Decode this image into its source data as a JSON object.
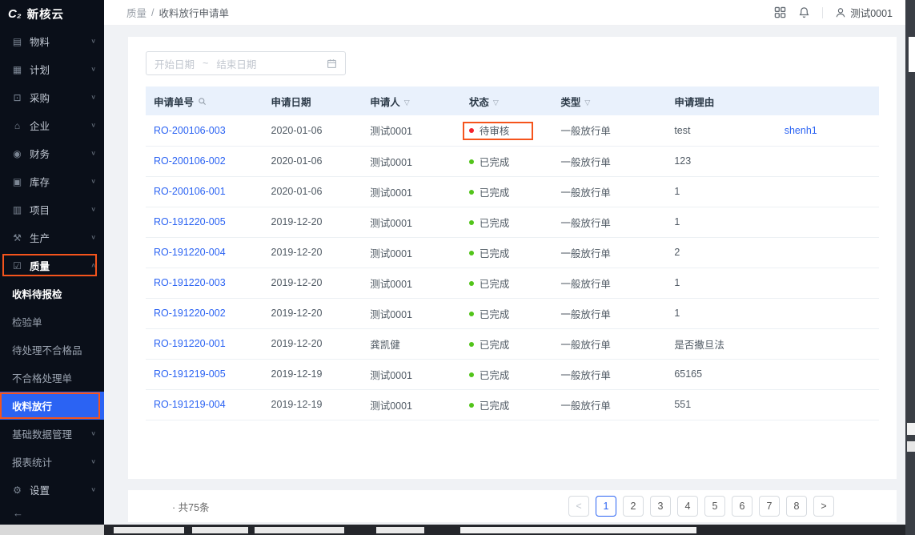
{
  "app": {
    "logo_mark": "C₂",
    "logo_text": "新核云"
  },
  "topbar": {
    "breadcrumb": {
      "section": "质量",
      "separator": "/",
      "page": "收料放行申请单"
    },
    "user": "测试0001"
  },
  "annotations": {
    "color": "#f5541c"
  },
  "icon_glyphs": {
    "materials-icon": "▤",
    "plan-icon": "▦",
    "purchase-icon": "⊡",
    "enterprise-icon": "⌂",
    "finance-icon": "◉",
    "inventory-icon": "▣",
    "project-icon": "▥",
    "production-icon": "⚒",
    "quality-icon": "☑",
    "settings-icon": "⚙",
    "chevron-down-icon": "∨",
    "chevron-up-icon": "∧",
    "filter-icon": "▽"
  },
  "sidebar": {
    "items": [
      {
        "name": "materials",
        "label": "物料",
        "icon": "materials-icon",
        "chevron": "down",
        "type": "top"
      },
      {
        "name": "plan",
        "label": "计划",
        "icon": "plan-icon",
        "chevron": "down",
        "type": "top"
      },
      {
        "name": "purchase",
        "label": "采购",
        "icon": "purchase-icon",
        "chevron": "down",
        "type": "top"
      },
      {
        "name": "enterprise",
        "label": "企业",
        "icon": "enterprise-icon",
        "chevron": "down",
        "type": "top"
      },
      {
        "name": "finance",
        "label": "财务",
        "icon": "finance-icon",
        "chevron": "down",
        "type": "top"
      },
      {
        "name": "inventory",
        "label": "库存",
        "icon": "inventory-icon",
        "chevron": "down",
        "type": "top"
      },
      {
        "name": "project",
        "label": "项目",
        "icon": "project-icon",
        "chevron": "down",
        "type": "top"
      },
      {
        "name": "production",
        "label": "生产",
        "icon": "production-icon",
        "chevron": "down",
        "type": "top"
      },
      {
        "name": "quality",
        "label": "质量",
        "icon": "quality-icon",
        "chevron": "up",
        "type": "top",
        "emphasized": true,
        "annotated": true
      },
      {
        "name": "receiving-pending-inspection",
        "label": "收料待报检",
        "type": "sub",
        "emphasized": true
      },
      {
        "name": "inspection-order",
        "label": "检验单",
        "type": "sub"
      },
      {
        "name": "pending-nonconforming",
        "label": "待处理不合格品",
        "type": "sub"
      },
      {
        "name": "nonconforming-order",
        "label": "不合格处理单",
        "type": "sub"
      },
      {
        "name": "receiving-release",
        "label": "收料放行",
        "type": "sub",
        "active": true,
        "annotated": true
      },
      {
        "name": "basic-data-management",
        "label": "基础数据管理",
        "type": "sub",
        "chevron": "down"
      },
      {
        "name": "report-statistics",
        "label": "报表统计",
        "type": "sub",
        "chevron": "down"
      },
      {
        "name": "settings",
        "label": "设置",
        "icon": "settings-icon",
        "chevron": "down",
        "type": "top"
      }
    ],
    "collapse_label": "←"
  },
  "filter": {
    "start_placeholder": "开始日期",
    "tilde": "~",
    "end_placeholder": "结束日期"
  },
  "table": {
    "headers": [
      {
        "name": "order-no",
        "label": "申请单号",
        "icon": "search-icon"
      },
      {
        "name": "apply-date",
        "label": "申请日期"
      },
      {
        "name": "applicant",
        "label": "申请人",
        "icon": "filter-icon"
      },
      {
        "name": "status",
        "label": "状态",
        "icon": "filter-icon"
      },
      {
        "name": "type",
        "label": "类型",
        "icon": "filter-icon"
      },
      {
        "name": "reason",
        "label": "申请理由"
      },
      {
        "name": "extra",
        "label": ""
      }
    ],
    "rows": [
      {
        "id": "RO-200106-003",
        "date": "2020-01-06",
        "applicant": "测试0001",
        "status": {
          "label": "待审核",
          "dot": "#f5222d"
        },
        "type": "一般放行单",
        "reason": "test",
        "extra": "shenh1",
        "annotated": true
      },
      {
        "id": "RO-200106-002",
        "date": "2020-01-06",
        "applicant": "测试0001",
        "status": {
          "label": "已完成",
          "dot": "#52c41a"
        },
        "type": "一般放行单",
        "reason": "123",
        "extra": ""
      },
      {
        "id": "RO-200106-001",
        "date": "2020-01-06",
        "applicant": "测试0001",
        "status": {
          "label": "已完成",
          "dot": "#52c41a"
        },
        "type": "一般放行单",
        "reason": "1",
        "extra": ""
      },
      {
        "id": "RO-191220-005",
        "date": "2019-12-20",
        "applicant": "测试0001",
        "status": {
          "label": "已完成",
          "dot": "#52c41a"
        },
        "type": "一般放行单",
        "reason": "1",
        "extra": ""
      },
      {
        "id": "RO-191220-004",
        "date": "2019-12-20",
        "applicant": "测试0001",
        "status": {
          "label": "已完成",
          "dot": "#52c41a"
        },
        "type": "一般放行单",
        "reason": "2",
        "extra": ""
      },
      {
        "id": "RO-191220-003",
        "date": "2019-12-20",
        "applicant": "测试0001",
        "status": {
          "label": "已完成",
          "dot": "#52c41a"
        },
        "type": "一般放行单",
        "reason": "1",
        "extra": ""
      },
      {
        "id": "RO-191220-002",
        "date": "2019-12-20",
        "applicant": "测试0001",
        "status": {
          "label": "已完成",
          "dot": "#52c41a"
        },
        "type": "一般放行单",
        "reason": "1",
        "extra": ""
      },
      {
        "id": "RO-191220-001",
        "date": "2019-12-20",
        "applicant": "龚凯健",
        "status": {
          "label": "已完成",
          "dot": "#52c41a"
        },
        "type": "一般放行单",
        "reason": "是否撒旦法",
        "extra": ""
      },
      {
        "id": "RO-191219-005",
        "date": "2019-12-19",
        "applicant": "测试0001",
        "status": {
          "label": "已完成",
          "dot": "#52c41a"
        },
        "type": "一般放行单",
        "reason": "65165",
        "extra": ""
      },
      {
        "id": "RO-191219-004",
        "date": "2019-12-19",
        "applicant": "测试0001",
        "status": {
          "label": "已完成",
          "dot": "#52c41a"
        },
        "type": "一般放行单",
        "reason": "551",
        "extra": ""
      }
    ]
  },
  "footer": {
    "total": "· 共75条",
    "prev": "<",
    "next": ">",
    "pages": [
      "1",
      "2",
      "3",
      "4",
      "5",
      "6",
      "7",
      "8"
    ],
    "active_page": "1"
  }
}
